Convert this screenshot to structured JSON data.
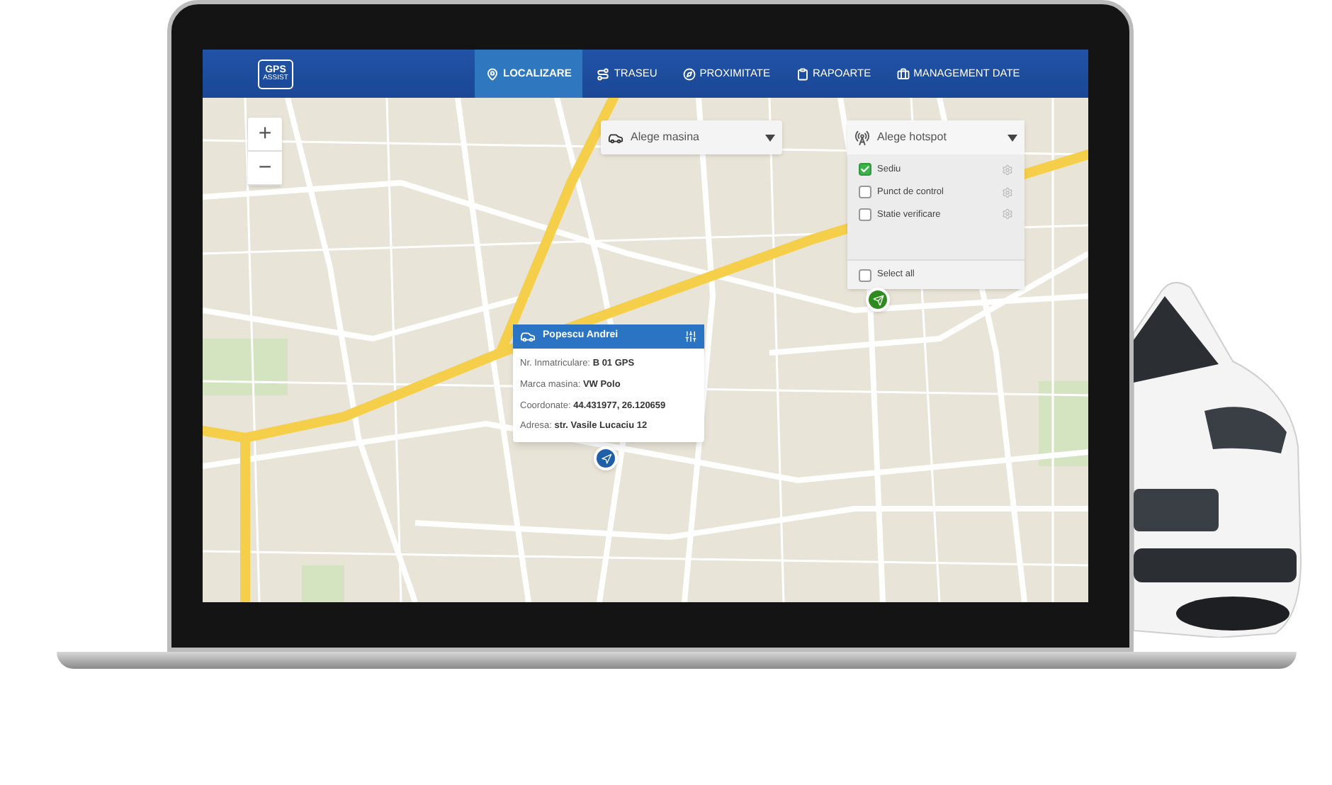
{
  "logo": {
    "line1": "GPS",
    "line2": "ASSIST"
  },
  "nav": [
    {
      "label": "LOCALIZARE",
      "selected": true
    },
    {
      "label": "TRASEU",
      "selected": false
    },
    {
      "label": "PROXIMITATE",
      "selected": false
    },
    {
      "label": "RAPOARTE",
      "selected": false
    },
    {
      "label": "MANAGEMENT DATE",
      "selected": false
    }
  ],
  "zoom_controls": [
    "+",
    "−"
  ],
  "vehicle_select": {
    "label": "Alege masina"
  },
  "hotspot_select": {
    "label": "Alege hotspot",
    "options": [
      {
        "label": "Sediu",
        "checked": true
      },
      {
        "label": "Punct de control",
        "checked": false
      },
      {
        "label": "Statie verificare",
        "checked": false
      }
    ],
    "select_all": {
      "label": "Select all",
      "checked": false
    }
  },
  "popup": {
    "title": "Popescu Andrei",
    "fields": [
      {
        "label": "Nr. Inmatriculare:",
        "value": "B 01 GPS"
      },
      {
        "label": "Marca masina:",
        "value": "VW Polo"
      },
      {
        "label": "Coordonate:",
        "value": "44.431977, 26.120659"
      },
      {
        "label": "Adresa:",
        "value": "str. Vasile Lucaciu 12"
      }
    ]
  },
  "markers": [
    {
      "kind": "vehicle",
      "color": "#1f5fa8"
    },
    {
      "kind": "hotspot",
      "color": "#2e8b1e"
    }
  ]
}
